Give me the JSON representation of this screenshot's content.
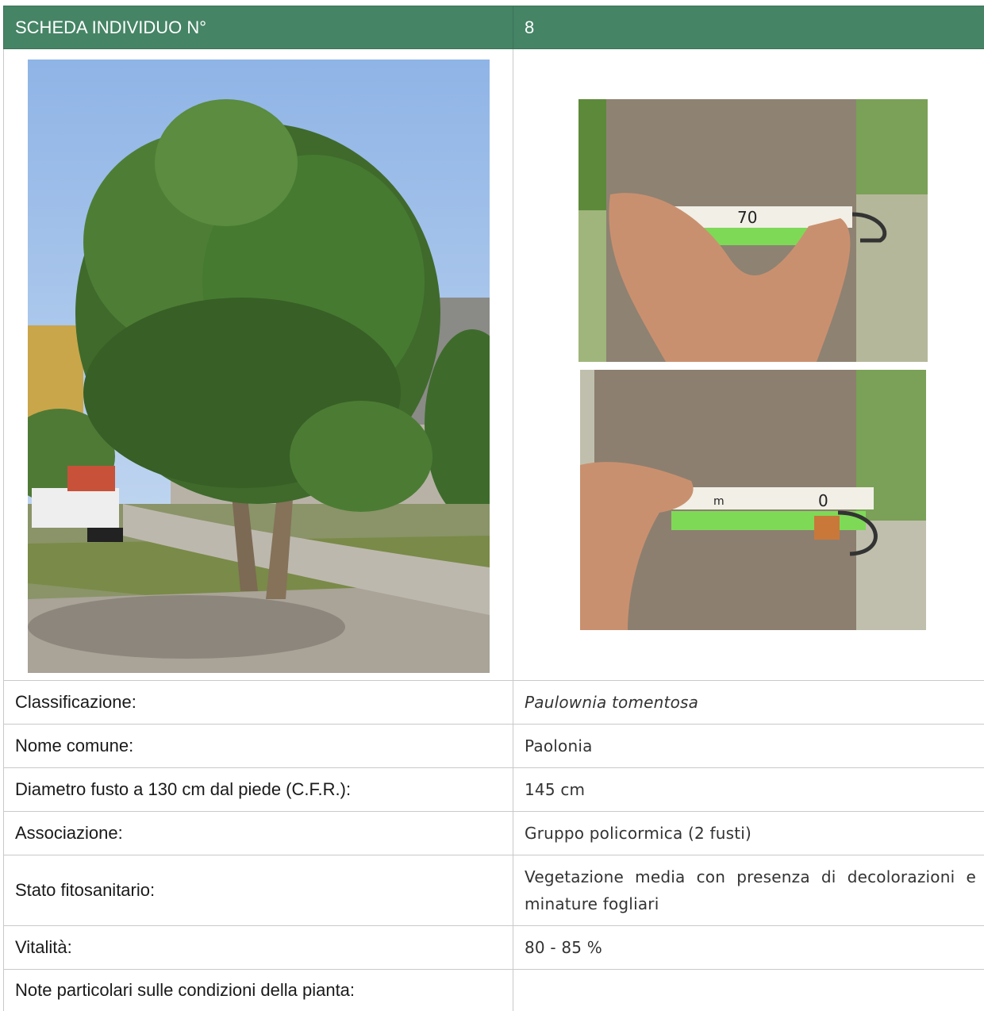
{
  "header": {
    "label": "SCHEDA INDIVIDUO N°",
    "number": "8"
  },
  "photos": {
    "tree": "tree-photo",
    "tape_top": "measuring-tape-photo",
    "tape_bottom": "measuring-tape-photo",
    "tape_marks": [
      "70",
      "0",
      "m"
    ]
  },
  "rows": [
    {
      "label": "Classificazione:",
      "value": "Paulownia tomentosa"
    },
    {
      "label": "Nome comune:",
      "value": "Paolonia"
    },
    {
      "label": "Diametro fusto a 130 cm dal piede (C.F.R.):",
      "value": "145 cm"
    },
    {
      "label": "Associazione:",
      "value": "Gruppo policormica (2 fusti)"
    },
    {
      "label": "Stato fitosanitario:",
      "value": "Vegetazione media con presenza di decolorazioni e minature fogliari"
    },
    {
      "label": "Vitalità:",
      "value": "80 - 85 %"
    },
    {
      "label": "Note particolari sulle condizioni della pianta:",
      "value": ""
    }
  ],
  "colors": {
    "header_bg": "#458465",
    "header_text": "#ffffff",
    "border": "#c9c9c9",
    "tape_green": "#7ed957"
  }
}
